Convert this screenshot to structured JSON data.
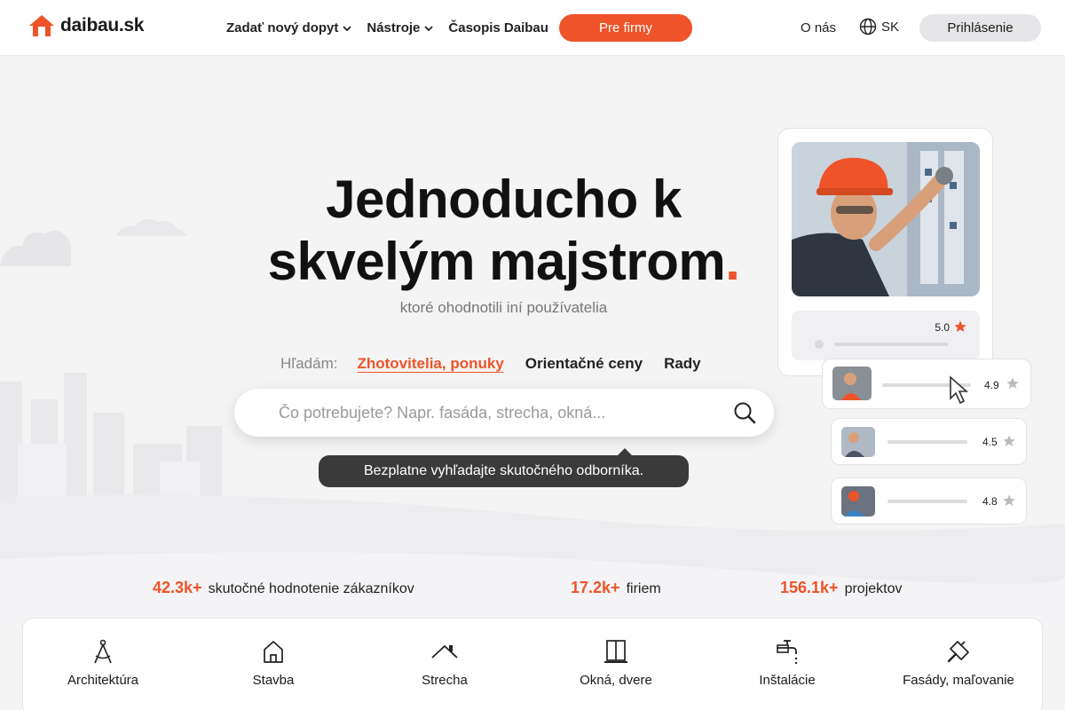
{
  "brand": {
    "name": "daibau.sk",
    "accent": "#ee5329"
  },
  "nav": {
    "items": [
      {
        "label": "Zadať nový dopyt",
        "has_dropdown": true
      },
      {
        "label": "Nástroje",
        "has_dropdown": true
      },
      {
        "label": "Časopis Daibau",
        "has_dropdown": false
      }
    ],
    "cta_label": "Pre firmy",
    "about_label": "O nás",
    "language": "SK",
    "login_label": "Prihlásenie"
  },
  "hero": {
    "title_line1": "Jednoducho k",
    "title_line2": "skvelým majstrom",
    "title_dot": ".",
    "subtitle": "ktoré ohodnotili iní používatelia"
  },
  "search": {
    "looking_for_label": "Hľadám:",
    "tabs": [
      {
        "label": "Zhotovitelia, ponuky",
        "active": true
      },
      {
        "label": "Orientačné ceny",
        "active": false
      },
      {
        "label": "Rady",
        "active": false
      }
    ],
    "placeholder": "Čo potrebujete? Napr. fasáda, strecha, okná...",
    "tooltip": "Bezplatne vyhľadajte skutočného odborníka."
  },
  "preview": {
    "main_rating": "5.0",
    "mini_ratings": [
      "4.9",
      "4.5",
      "4.8"
    ]
  },
  "stats": [
    {
      "value": "42.3k+",
      "label": "skutočné hodnotenie zákazníkov"
    },
    {
      "value": "17.2k+",
      "label": "firiem"
    },
    {
      "value": "156.1k+",
      "label": "projektov"
    }
  ],
  "categories": [
    {
      "label": "Architektúra",
      "icon": "compass-icon"
    },
    {
      "label": "Stavba",
      "icon": "house-icon"
    },
    {
      "label": "Strecha",
      "icon": "roof-icon"
    },
    {
      "label": "Okná, dvere",
      "icon": "door-icon"
    },
    {
      "label": "Inštalácie",
      "icon": "faucet-icon"
    },
    {
      "label": "Fasády, maľovanie",
      "icon": "trowel-icon"
    }
  ]
}
